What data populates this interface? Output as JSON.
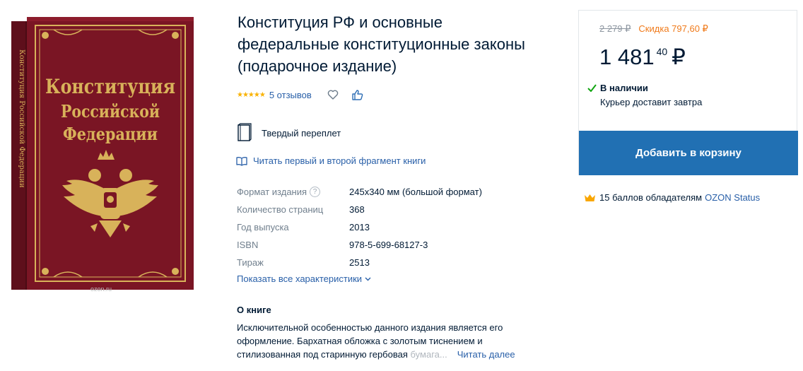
{
  "product": {
    "title": "Конституция РФ и основные федеральные конституционные законы (подарочное издание)",
    "rating_stars": "★★★★★",
    "reviews": "5 отзывов",
    "binding": "Твердый переплет",
    "read_fragment": "Читать первый и второй фрагмент книги",
    "cover": {
      "line1": "Конституция",
      "line2": "Российской",
      "line3": "Федерации",
      "spine": "Конституция Российской Федерации",
      "watermark": "ozon.ru"
    }
  },
  "specs": [
    {
      "key": "Формат издания",
      "value": "245х340 мм (большой формат)",
      "help": "?"
    },
    {
      "key": "Количество страниц",
      "value": "368"
    },
    {
      "key": "Год выпуска",
      "value": "2013"
    },
    {
      "key": "ISBN",
      "value": "978-5-699-68127-3"
    },
    {
      "key": "Тираж",
      "value": "2513"
    }
  ],
  "show_all": "Показать все характеристики",
  "about": {
    "title": "О книге",
    "text": "Исключительной особенностью данного издания является его оформление. Бархатная обложка с золотым тиснением и стилизованная под старинную гербовая ",
    "text_fade": "бумага...",
    "read_more": "Читать далее"
  },
  "buy": {
    "old_price": "2 279 ₽",
    "discount": "Скидка 797,60 ₽",
    "price_main": "1 481",
    "price_kop": "40",
    "currency": "₽",
    "stock": "В наличии",
    "delivery": "Курьер доставит завтра",
    "add_to_cart": "Добавить в корзину"
  },
  "status": {
    "text": "15 баллов обладателям",
    "link": "OZON Status"
  },
  "colors": {
    "accent_blue": "#2170b3",
    "link_blue": "#285fa8",
    "discount_orange": "#f07a1a",
    "star_gold": "#f9b200",
    "cover_red": "#7a1524",
    "cover_gold": "#d8b25a"
  },
  "icons": [
    "heart-icon",
    "thumbs-up-icon",
    "book-binding-icon",
    "open-book-icon",
    "help-icon",
    "chevron-down-icon",
    "checkmark-icon",
    "crown-icon"
  ]
}
